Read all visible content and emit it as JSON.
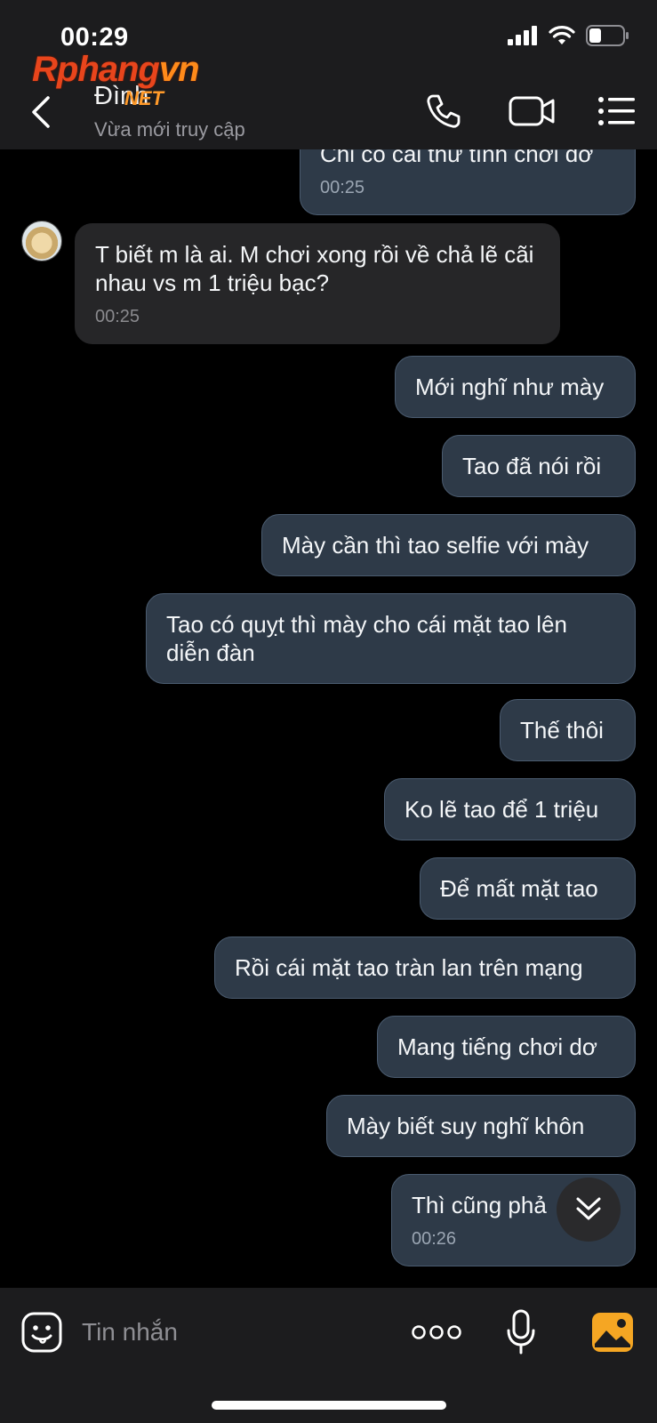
{
  "status_bar": {
    "time": "00:29"
  },
  "watermark": {
    "brand": "Rphangvn",
    "brand_accent": "vn",
    "sub": "NET"
  },
  "header": {
    "contact_name": "Đình",
    "contact_status": "Vừa mới truy cập",
    "icons": [
      "back-chevron-icon",
      "phone-icon",
      "video-camera-icon",
      "menu-list-icon"
    ]
  },
  "messages": [
    {
      "direction": "out",
      "text": "Chỉ có cái thư tình chơi dơ",
      "time": "00:25",
      "partially_hidden": true
    },
    {
      "direction": "in",
      "text": "T biết m là ai. M chơi xong rồi về chả lẽ cãi nhau vs m 1 triệu bạc?",
      "time": "00:25"
    },
    {
      "direction": "out",
      "text": "Mới nghĩ như mày"
    },
    {
      "direction": "out",
      "text": "Tao đã nói rồi"
    },
    {
      "direction": "out",
      "text": "Mày cần thì tao selfie với mày"
    },
    {
      "direction": "out",
      "text": "Tao có quỵt thì mày cho cái mặt tao lên diễn đàn"
    },
    {
      "direction": "out",
      "text": "Thế thôi"
    },
    {
      "direction": "out",
      "text": "Ko lẽ tao để 1 triệu"
    },
    {
      "direction": "out",
      "text": "Để mất mặt tao"
    },
    {
      "direction": "out",
      "text": "Rồi cái mặt tao tràn lan trên mạng"
    },
    {
      "direction": "out",
      "text": "Mang tiếng chơi dơ"
    },
    {
      "direction": "out",
      "text": "Mày biết suy nghĩ khôn"
    },
    {
      "direction": "out",
      "text": "Thì cũng phả",
      "time": "00:26"
    }
  ],
  "composer": {
    "placeholder": "Tin nhắn",
    "icons": [
      "sticker-icon",
      "more-dots-icon",
      "microphone-icon",
      "photo-gallery-icon"
    ]
  },
  "colors": {
    "background": "#000000",
    "bar": "#1c1c1e",
    "outgoing_bubble": "#2e3a48",
    "incoming_bubble": "#262628",
    "gallery_icon": "#f5a623"
  }
}
